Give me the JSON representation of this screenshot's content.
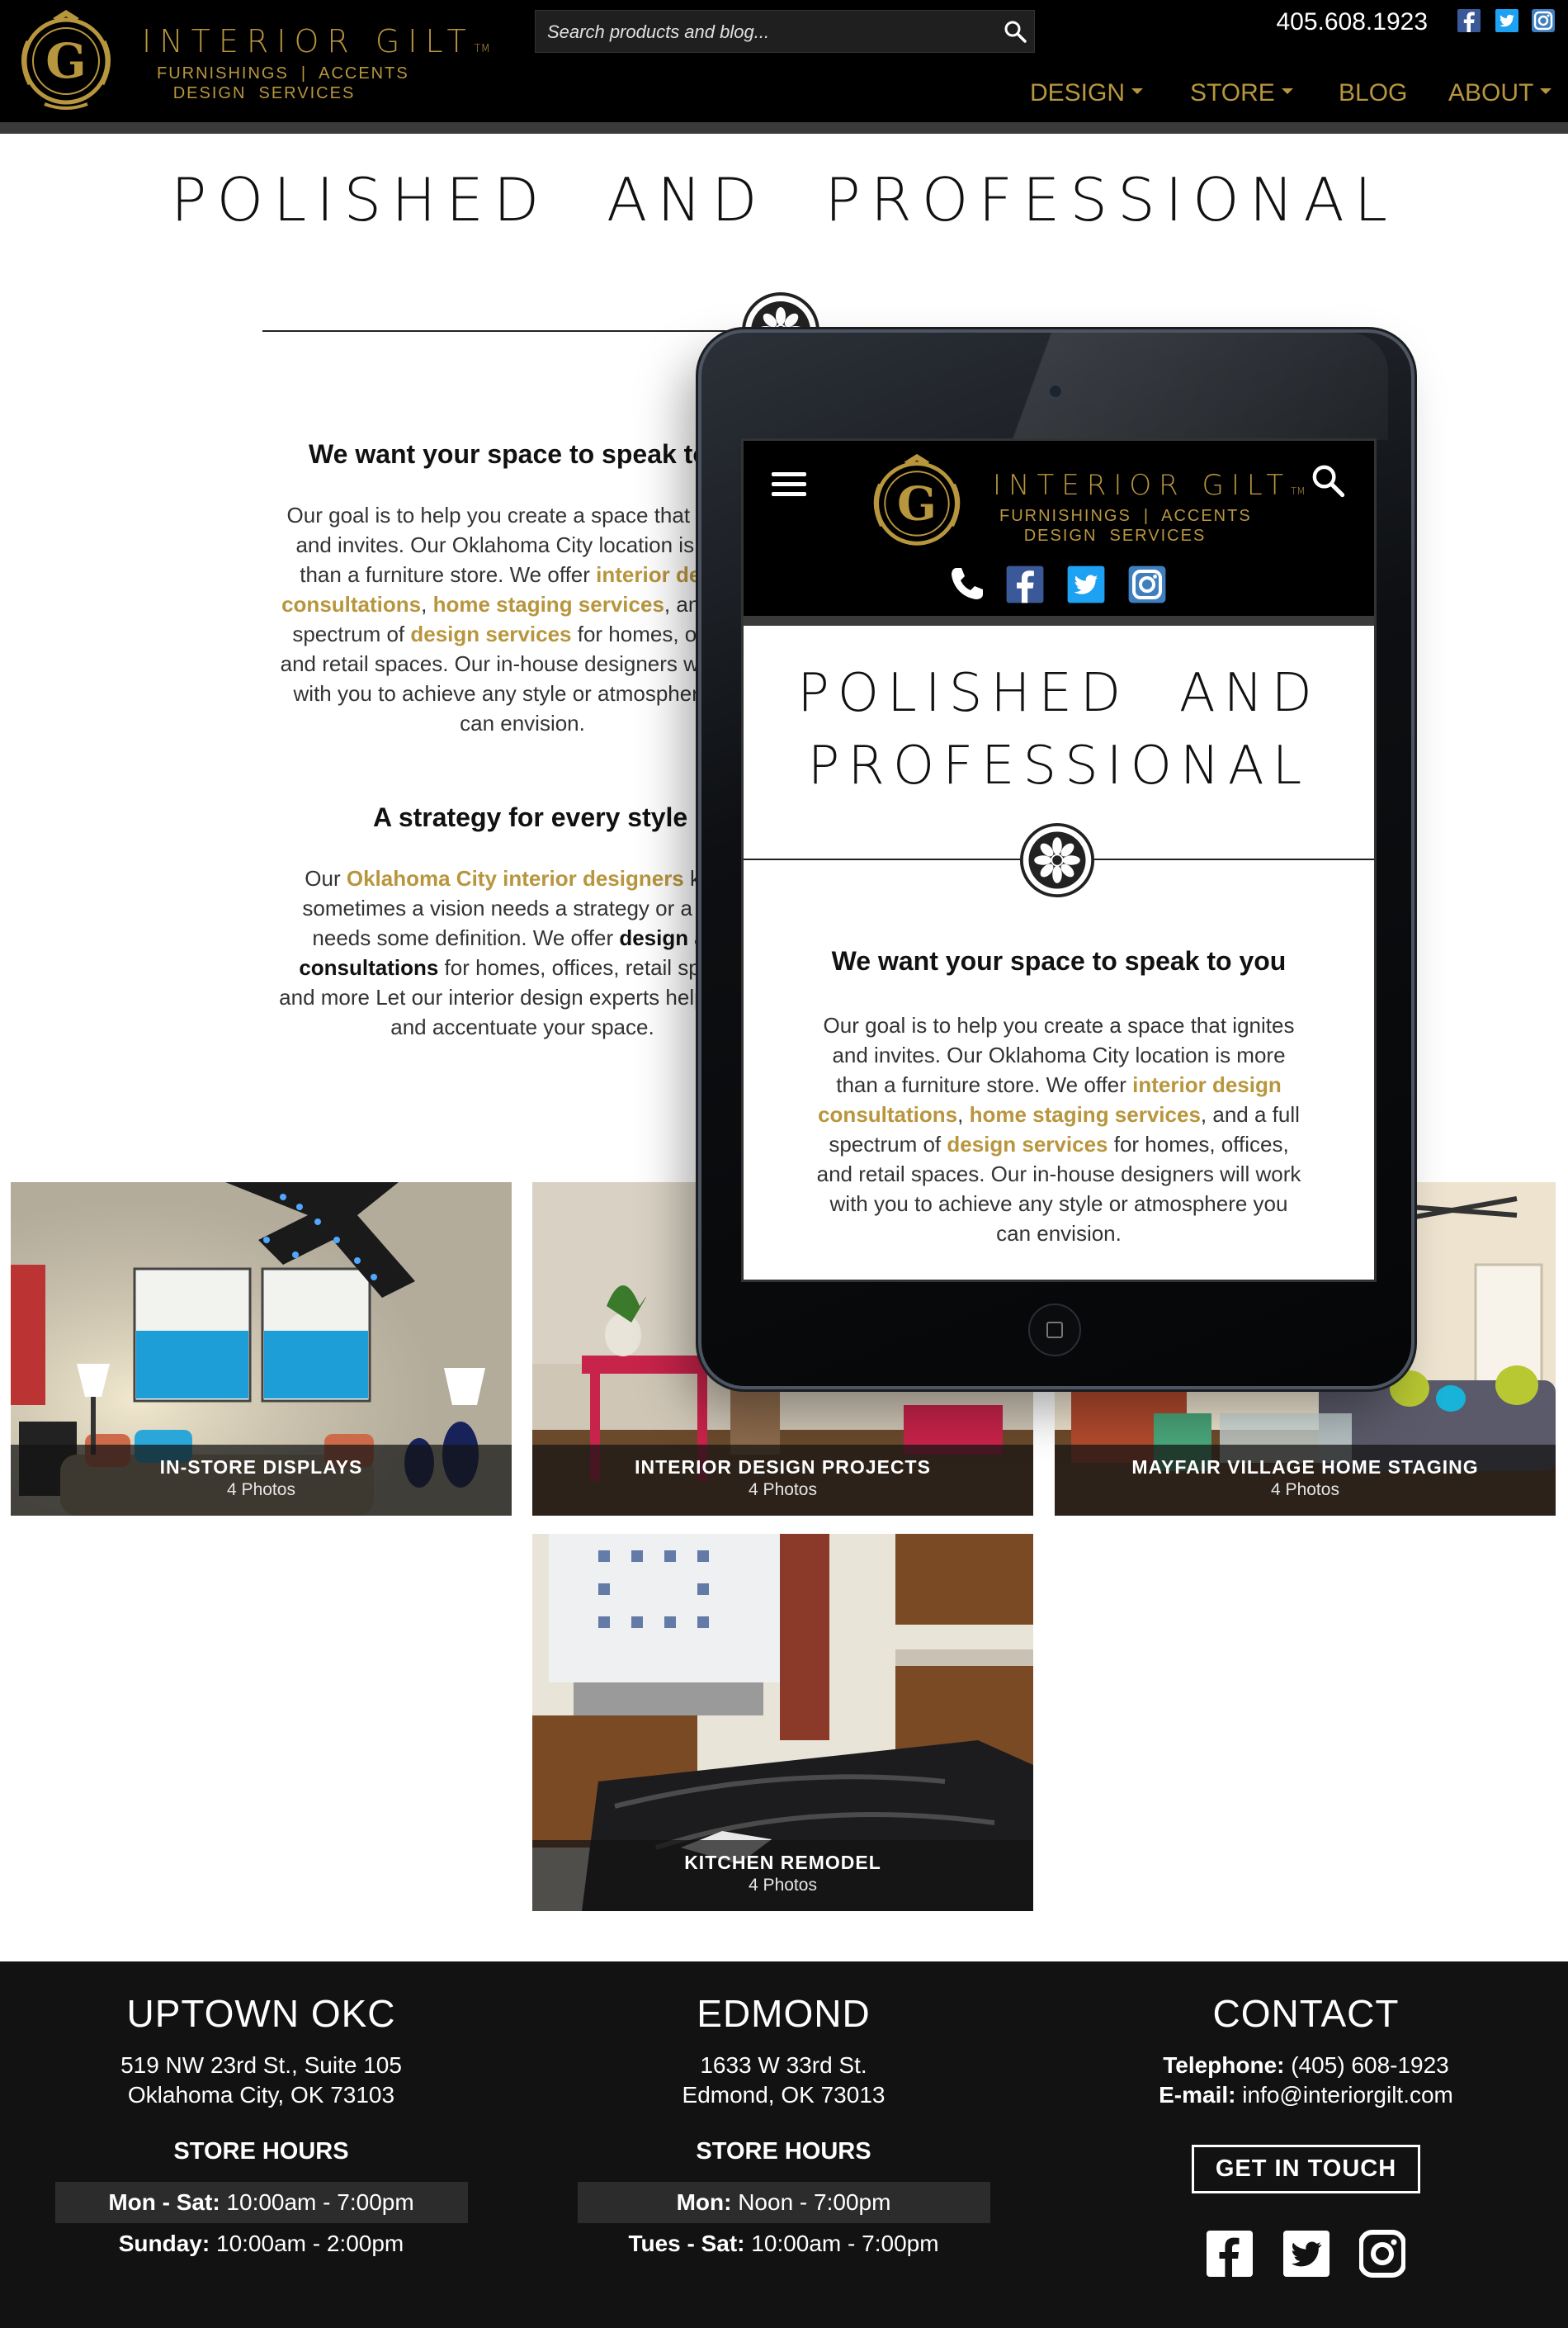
{
  "header": {
    "brand_name": "INTERIOR GILT",
    "brand_tm": "TM",
    "brand_line1": "FURNISHINGS  |  ACCENTS",
    "brand_line2": "DESIGN  SERVICES",
    "search_placeholder": "Search products and blog...",
    "phone": "405.608.1923",
    "social_icons": [
      "facebook-icon",
      "twitter-icon",
      "instagram-icon"
    ],
    "nav": [
      {
        "label": "DESIGN",
        "dropdown": true
      },
      {
        "label": "STORE",
        "dropdown": true
      },
      {
        "label": "BLOG",
        "dropdown": false
      },
      {
        "label": "ABOUT",
        "dropdown": true
      }
    ]
  },
  "main": {
    "title": "POLISHED  AND  PROFESSIONAL",
    "section1": {
      "heading": "We want your space to speak to you",
      "p_a": "Our goal is to help you create a space that ignites and invites. Our Oklahoma City location is more than a furniture store. We offer ",
      "link1": "interior design consultations",
      "p_b": ", ",
      "link2": "home staging services",
      "p_c": ", and a full spectrum of ",
      "link3": "design services",
      "p_d": " for homes, offices, and retail spaces. Our in-house designers will work with you to achieve any style or atmosphere you can envision."
    },
    "section2": {
      "heading": "A strategy for every style",
      "p_a": "Our ",
      "link1": "Oklahoma City interior designers",
      "p_b": " know sometimes a vision needs a strategy or a style needs some definition. We offer ",
      "bold1": "design and consultations",
      "p_c": " for homes, offices, retail spaces and more  Let our interior design experts help refine and accentuate your space."
    }
  },
  "gallery": [
    {
      "title": "IN-STORE DISPLAYS",
      "count": "4 Photos"
    },
    {
      "title": "INTERIOR DESIGN PROJECTS",
      "count": "4 Photos"
    },
    {
      "title": "MAYFAIR VILLAGE HOME STAGING",
      "count": "4 Photos"
    },
    {
      "title": "KITCHEN REMODEL",
      "count": "4 Photos"
    }
  ],
  "tablet": {
    "title_line1": "POLISHED  AND",
    "title_line2": "PROFESSIONAL",
    "heading": "We want your space to speak to you"
  },
  "footer": {
    "col1": {
      "title": "UPTOWN OKC",
      "addr1": "519 NW 23rd St., Suite 105",
      "addr2": "Oklahoma City, OK 73103",
      "hours_title": "STORE HOURS",
      "h1_label": "Mon - Sat:",
      "h1_value": " 10:00am - 7:00pm",
      "h2_label": "Sunday:",
      "h2_value": " 10:00am - 2:00pm"
    },
    "col2": {
      "title": "EDMOND",
      "addr1": "1633 W 33rd St.",
      "addr2": "Edmond, OK 73013",
      "hours_title": "STORE HOURS",
      "h1_label": "Mon:",
      "h1_value": " Noon - 7:00pm",
      "h2_label": "Tues - Sat:",
      "h2_value": " 10:00am - 7:00pm"
    },
    "col3": {
      "title": "CONTACT",
      "tel_label": "Telephone:",
      "tel_value": " (405) 608-1923",
      "email_label": "E-mail:",
      "email_value": " info@interiorgilt.com",
      "button": "GET IN TOUCH"
    }
  },
  "colors": {
    "accent_gold": "#b8963e",
    "header_bg": "#000000",
    "footer_bg": "#121212"
  }
}
